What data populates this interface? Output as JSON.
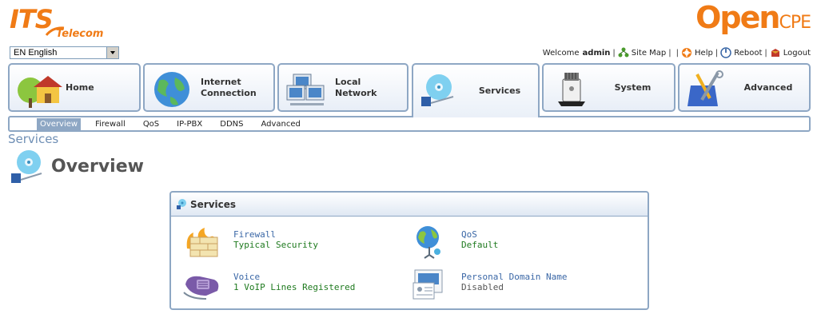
{
  "brand": {
    "left_logo_main": "ITS",
    "left_logo_sub": "Telecom",
    "right_logo_open": "Open",
    "right_logo_cpe": "CPE",
    "accent_color": "#f07b16"
  },
  "language": {
    "selected": "EN English"
  },
  "toplinks": {
    "welcome": "Welcome",
    "user": "admin",
    "site_map": "Site Map",
    "help": "Help",
    "reboot": "Reboot",
    "logout": "Logout",
    "separator": "|"
  },
  "tabs": [
    {
      "label": "Home",
      "icon": "house-icon"
    },
    {
      "label": "Internet\nConnection",
      "icon": "globe-icon"
    },
    {
      "label": "Local\nNetwork",
      "icon": "network-icon"
    },
    {
      "label": "Services",
      "icon": "services-disc-icon",
      "active": true
    },
    {
      "label": "System",
      "icon": "router-icon"
    },
    {
      "label": "Advanced",
      "icon": "tools-icon"
    }
  ],
  "subnav": [
    {
      "label": "Overview",
      "active": true
    },
    {
      "label": "Firewall"
    },
    {
      "label": "QoS"
    },
    {
      "label": "IP-PBX"
    },
    {
      "label": "DDNS"
    },
    {
      "label": "Advanced"
    }
  ],
  "page": {
    "breadcrumb": "Services",
    "title": "Overview"
  },
  "panel": {
    "title": "Services",
    "items": [
      {
        "name": "Firewall",
        "status": "Typical Security",
        "icon": "firewall-icon"
      },
      {
        "name": "QoS",
        "status": "Default",
        "icon": "qos-globe-icon"
      },
      {
        "name": "Voice",
        "status": "1 VoIP Lines Registered",
        "icon": "voip-phone-icon"
      },
      {
        "name": "Personal Domain Name",
        "status": "Disabled",
        "icon": "domain-card-icon"
      }
    ]
  }
}
